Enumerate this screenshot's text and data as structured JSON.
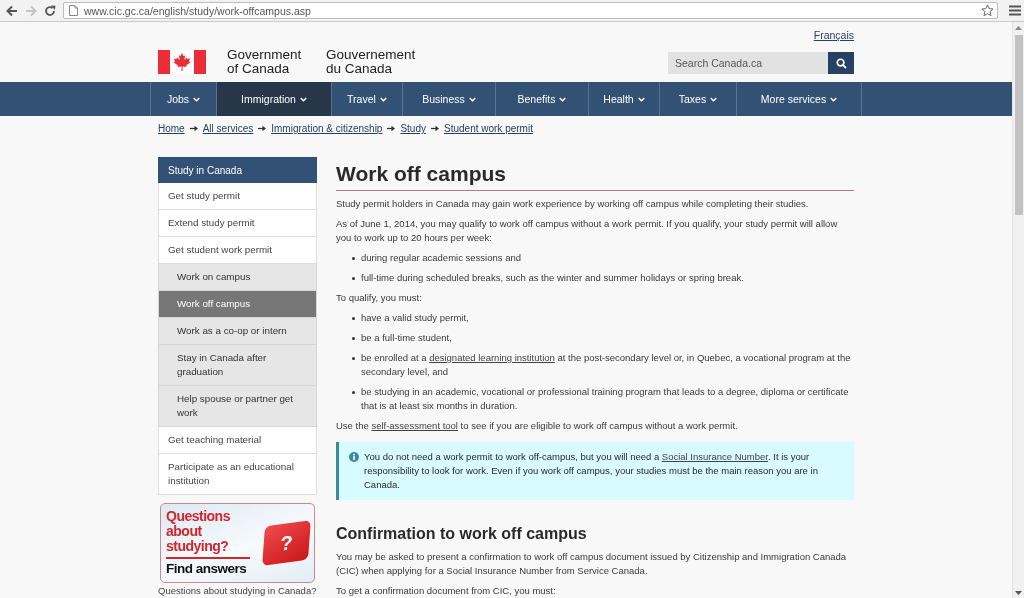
{
  "browser": {
    "buttons": [
      {
        "kind": "back",
        "disabled": false
      },
      {
        "kind": "forward",
        "disabled": true
      },
      {
        "kind": "reload",
        "disabled": false
      }
    ],
    "url": "www.cic.gc.ca/english/study/work-offcampus.asp"
  },
  "header": {
    "language_link": "Français",
    "signature": [
      "Government of Canada",
      "Gouvernement du Canada"
    ],
    "search": {
      "placeholder": "Search Canada.ca"
    }
  },
  "nav": [
    {
      "label": "Jobs",
      "selected": false
    },
    {
      "label": "Immigration",
      "selected": true
    },
    {
      "label": "Travel",
      "selected": false
    },
    {
      "label": "Business",
      "selected": false
    },
    {
      "label": "Benefits",
      "selected": false
    },
    {
      "label": "Health",
      "selected": false
    },
    {
      "label": "Taxes",
      "selected": false
    },
    {
      "label": "More services",
      "selected": false
    }
  ],
  "breadcrumb": [
    "Home",
    "All services",
    "Immigration & citizenship",
    "Study",
    "Student work permit"
  ],
  "sidebar": {
    "heading": "Study in Canada",
    "items": [
      {
        "label": "Get study permit",
        "selected": false
      },
      {
        "label": "Extend study permit",
        "selected": false
      },
      {
        "label": "Get student work permit",
        "selected": false,
        "children": [
          {
            "label": "Work on campus",
            "selected": false
          },
          {
            "label": "Work off campus",
            "selected": true
          },
          {
            "label": "Work as a co-op or intern",
            "selected": false
          },
          {
            "label": "Stay in Canada after graduation",
            "selected": false
          },
          {
            "label": "Help spouse or partner get work",
            "selected": false
          }
        ]
      },
      {
        "label": "Get teaching material",
        "selected": false
      },
      {
        "label": "Participate as an educational institution",
        "selected": false
      }
    ]
  },
  "banner": {
    "headline": "Questions about studying?",
    "action": "Find answers",
    "key": "?",
    "caption": "Questions about studying in Canada?"
  },
  "main": {
    "title": "Work off campus",
    "blocks": [
      {
        "kind": "paragraph",
        "parts": [
          {
            "kind": "text",
            "text": "Study permit holders in Canada may gain work experience by working off campus while completing their studies."
          }
        ]
      },
      {
        "kind": "paragraph",
        "parts": [
          {
            "kind": "text",
            "text": "As of June 1, 2014, you may qualify to work off campus without a work permit. If you qualify, your study permit will allow you to work up to 20 hours per week:"
          }
        ]
      },
      {
        "kind": "list",
        "items": [
          {
            "parts": [
              {
                "kind": "text",
                "text": "during regular academic sessions and"
              }
            ]
          },
          {
            "parts": [
              {
                "kind": "text",
                "text": "full-time during scheduled breaks, such as the winter and summer holidays or spring break."
              }
            ]
          }
        ]
      },
      {
        "kind": "paragraph",
        "parts": [
          {
            "kind": "text",
            "text": "To qualify, you must:"
          }
        ]
      },
      {
        "kind": "list",
        "items": [
          {
            "parts": [
              {
                "kind": "text",
                "text": "have a valid study permit,"
              }
            ]
          },
          {
            "parts": [
              {
                "kind": "text",
                "text": "be a full-time student,"
              }
            ]
          },
          {
            "parts": [
              {
                "kind": "text",
                "text": "be enrolled at a "
              },
              {
                "kind": "link",
                "text": "designated learning institution"
              },
              {
                "kind": "text",
                "text": " at the post-secondary level or, in Quebec, a vocational program at the secondary level, and"
              }
            ]
          },
          {
            "parts": [
              {
                "kind": "text",
                "text": "be studying in an academic, vocational or professional training program that leads to a degree, diploma or certificate that is at least six months in duration."
              }
            ]
          }
        ]
      },
      {
        "kind": "paragraph",
        "parts": [
          {
            "kind": "text",
            "text": "Use the "
          },
          {
            "kind": "link",
            "text": "self-assessment tool"
          },
          {
            "kind": "text",
            "text": " to see if you are eligible to work off campus without a work permit."
          }
        ]
      },
      {
        "kind": "note",
        "parts": [
          {
            "kind": "text",
            "text": "You do not need a work permit to work off-campus, but you will need a "
          },
          {
            "kind": "link",
            "text": "Social Insurance Number"
          },
          {
            "kind": "text",
            "text": ". It is your responsibility to look for work. Even if you work off campus, your studies must be the main reason you are in Canada."
          }
        ]
      },
      {
        "kind": "heading",
        "text": "Confirmation to work off campus"
      },
      {
        "kind": "paragraph",
        "parts": [
          {
            "kind": "text",
            "text": "You may be asked to present a confirmation to work off campus document issued by Citizenship and Immigration Canada (CIC) when applying for a Social Insurance Number from Service Canada."
          }
        ]
      },
      {
        "kind": "paragraph",
        "parts": [
          {
            "kind": "text",
            "text": "To get a confirmation document from CIC, you must:"
          }
        ]
      }
    ]
  }
}
